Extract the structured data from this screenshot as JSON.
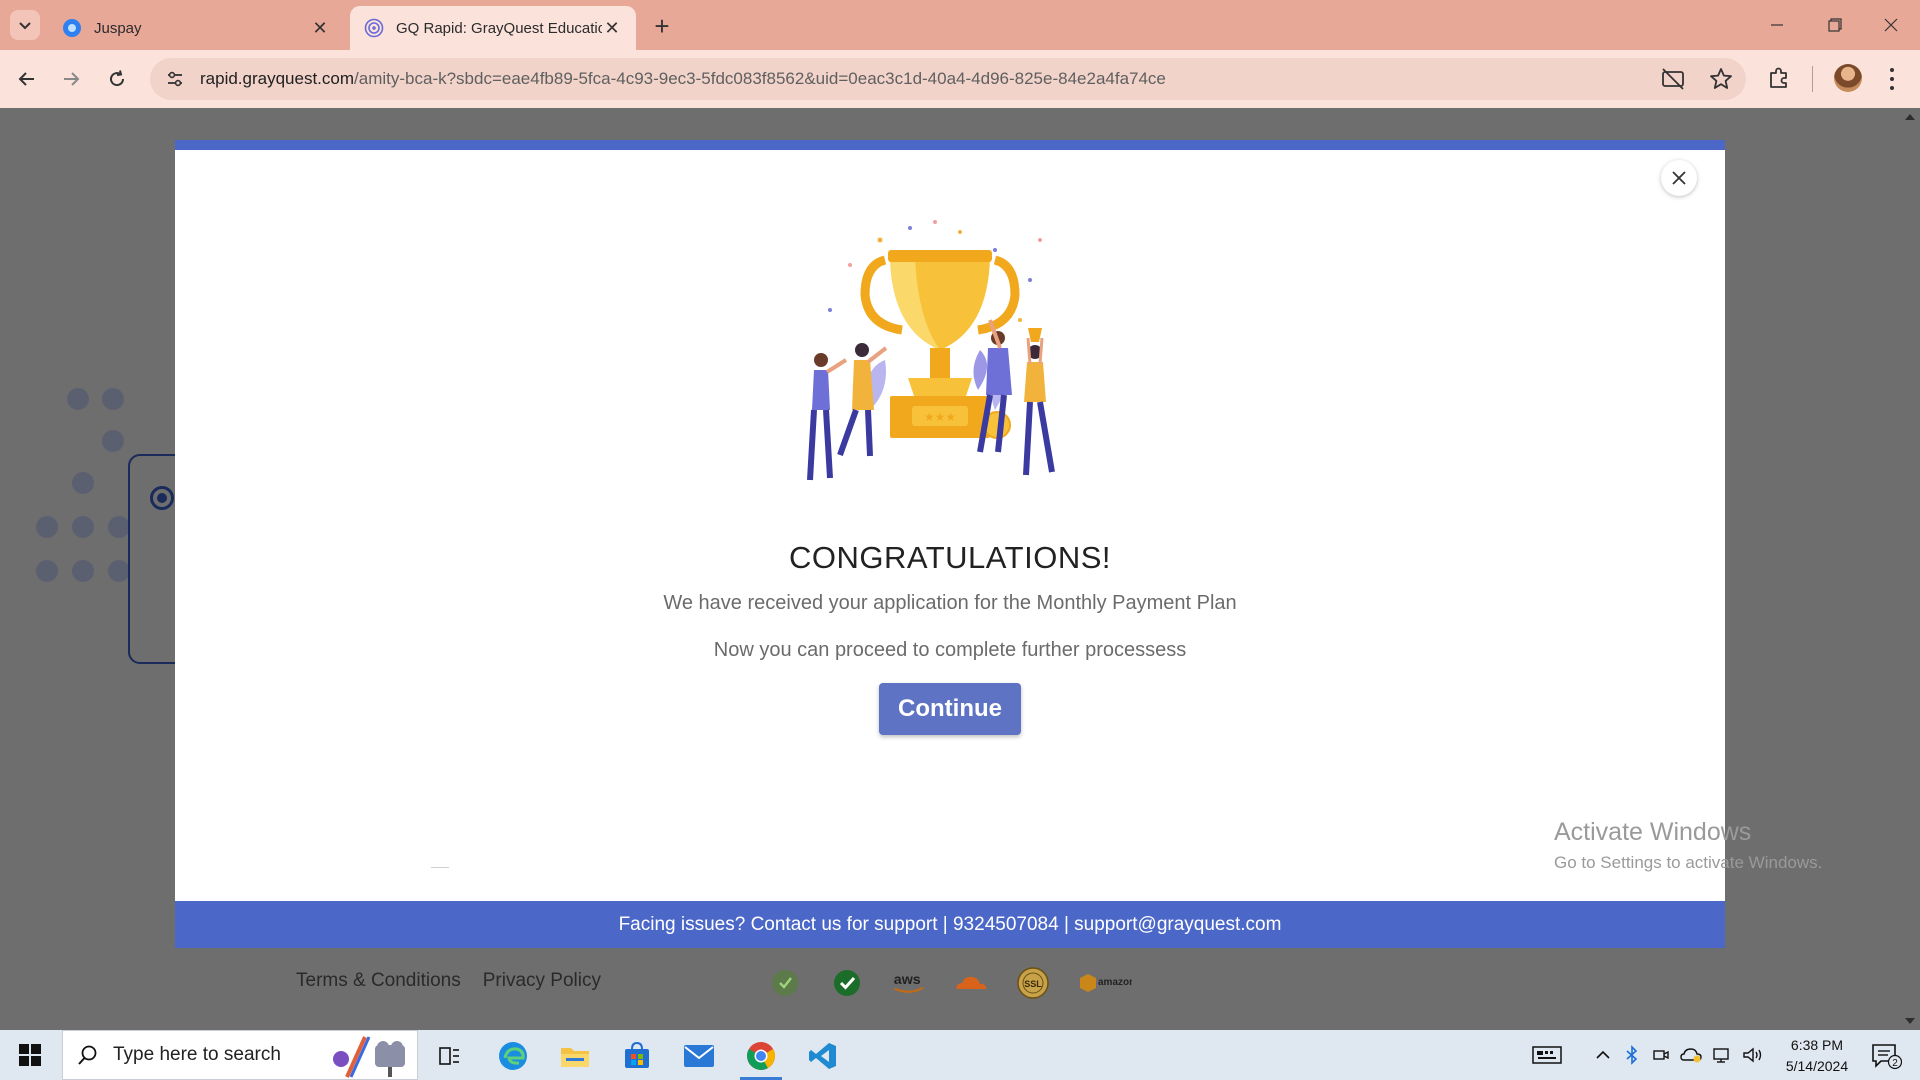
{
  "browser": {
    "tabs": [
      {
        "label": "Juspay",
        "active": false
      },
      {
        "label": "GQ Rapid: GrayQuest Education",
        "active": true
      }
    ],
    "url_host": "rapid.grayquest.com",
    "url_path": "/amity-bca-k?sbdc=eae4fb89-5fca-4c93-9ec3-5fdc083f8562&uid=0eac3c1d-40a4-4d96-825e-84e2a4fa74ce"
  },
  "modal": {
    "title": "CONGRATULATIONS!",
    "line1": "We have received your application for the Monthly Payment Plan",
    "line2": "Now you can proceed to complete further processess",
    "continue_label": "Continue",
    "support_text": "Facing issues? Contact us for support | 9324507084 | support@grayquest.com"
  },
  "footer": {
    "terms": "Terms & Conditions",
    "privacy": "Privacy Policy",
    "badges": [
      "verified-shield-icon",
      "check-badge-icon",
      "aws-logo",
      "cloudflare-logo",
      "ssl-seal-icon",
      "amazon-rds-logo"
    ],
    "aws_text": "aws",
    "ssl_text": "SSL",
    "rds_text": "amazon"
  },
  "watermark": {
    "line1": "Activate Windows",
    "line2": "Go to Settings to activate Windows."
  },
  "taskbar": {
    "search_placeholder": "Type here to search",
    "time": "6:38 PM",
    "date": "5/14/2024",
    "notification_count": "2"
  },
  "colors": {
    "brand_blue": "#4b67c8",
    "button": "#5e73c4",
    "tab_strip": "#e8a898"
  }
}
